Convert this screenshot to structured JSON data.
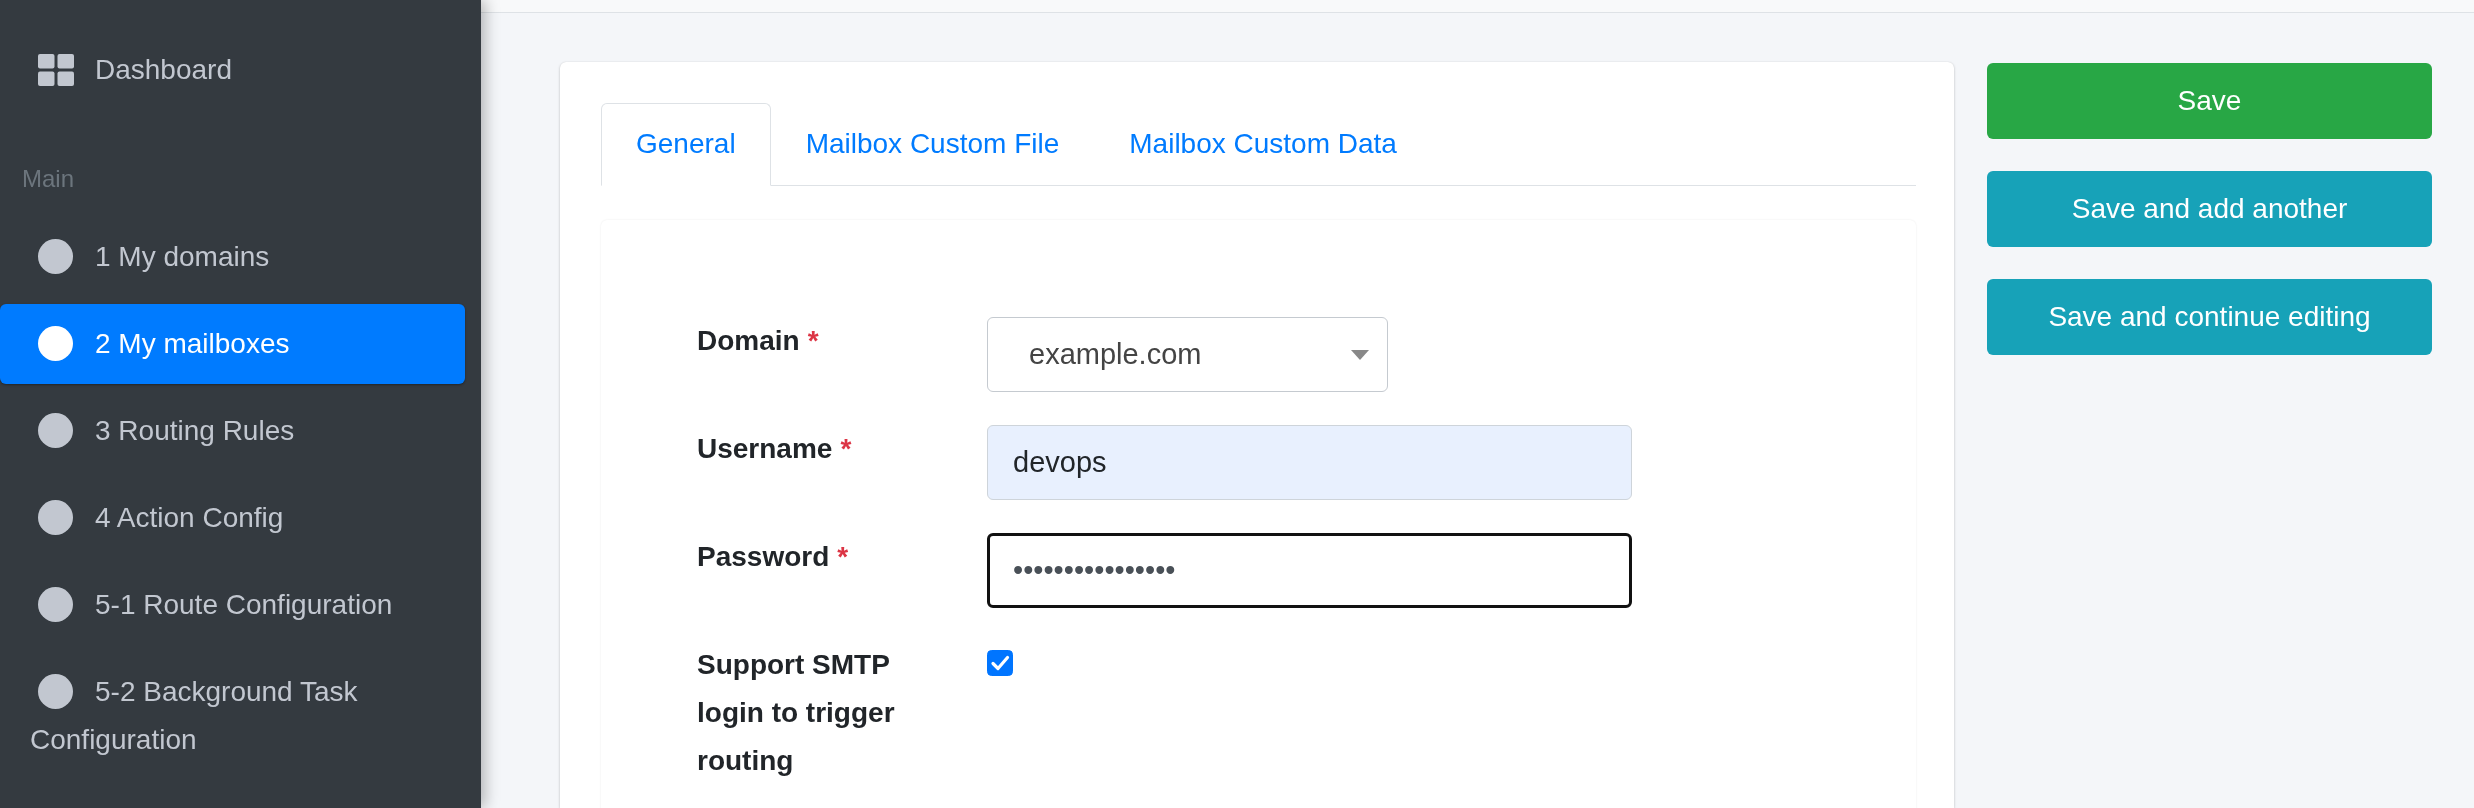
{
  "sidebar": {
    "top_items": [
      {
        "label": "Dashboard",
        "selected": false
      }
    ],
    "section_header": "Main",
    "items": [
      {
        "label": "1 My domains",
        "selected": false
      },
      {
        "label": "2 My mailboxes",
        "selected": true
      },
      {
        "label": "3 Routing Rules",
        "selected": false
      },
      {
        "label": "4 Action Config",
        "selected": false
      },
      {
        "label": "5-1 Route Configuration",
        "selected": false
      },
      {
        "label": "5-2 Background Task Configuration",
        "selected": false
      }
    ]
  },
  "form": {
    "tabs": [
      {
        "label": "General",
        "selected": true
      },
      {
        "label": "Mailbox Custom File",
        "selected": false
      },
      {
        "label": "Mailbox Custom Data",
        "selected": false
      }
    ],
    "fields": [
      {
        "kind": "select",
        "label": "Domain",
        "required_mark": "*",
        "value": "example.com",
        "focused": false,
        "autofilled": false
      },
      {
        "kind": "text",
        "label": "Username",
        "required_mark": "*",
        "value": "devops",
        "focused": false,
        "autofilled": true
      },
      {
        "kind": "password",
        "label": "Password",
        "required_mark": "*",
        "value": "••••••••••••••••",
        "focused": true,
        "autofilled": false
      },
      {
        "kind": "checkbox",
        "label": "Support SMTP login to trigger routing",
        "checked": true,
        "focused": false,
        "autofilled": false
      }
    ]
  },
  "actions": [
    {
      "label": "Save",
      "kind": "success"
    },
    {
      "label": "Save and add another",
      "kind": "info"
    },
    {
      "label": "Save and continue editing",
      "kind": "info"
    }
  ]
}
